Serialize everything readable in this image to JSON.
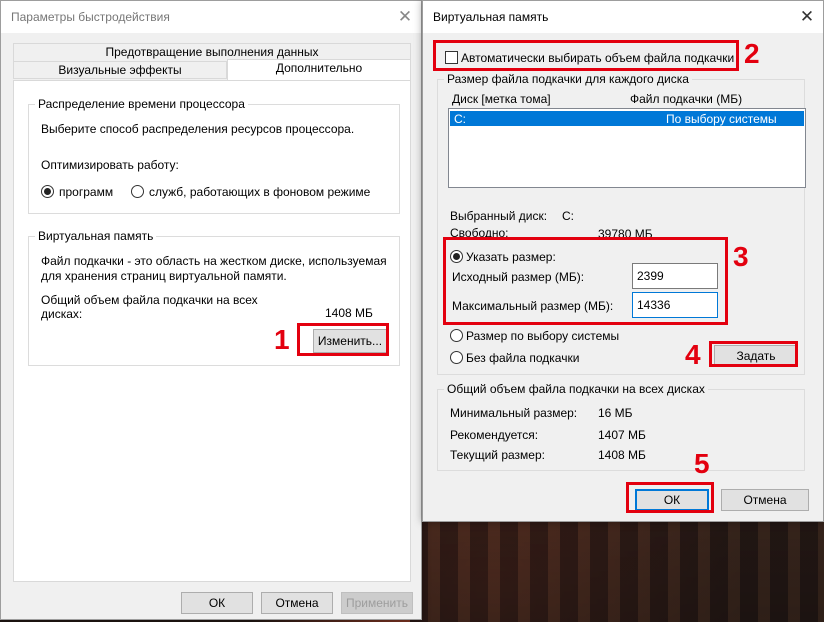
{
  "perf_dialog": {
    "title": "Параметры быстродействия",
    "close_glyph": "✕",
    "tabs": [
      {
        "label": "Предотвращение выполнения данных"
      },
      {
        "label": "Визуальные эффекты"
      },
      {
        "label": "Дополнительно"
      }
    ],
    "cpu_group": {
      "title": "Распределение времени процессора",
      "description": "Выберите способ распределения ресурсов процессора.",
      "optimize_label": "Оптимизировать работу:",
      "options": [
        "программ",
        "служб, работающих в фоновом режиме"
      ],
      "selected_index": 0
    },
    "vm_group": {
      "title": "Виртуальная память",
      "description_line1": "Файл подкачки - это область на жестком диске, используемая",
      "description_line2": "для хранения страниц виртуальной памяти.",
      "total_label_line1": "Общий объем файла подкачки на всех",
      "total_label_line2": "дисках:",
      "total_value": "1408 МБ",
      "change_button": "Изменить..."
    },
    "buttons": {
      "ok": "ОК",
      "cancel": "Отмена",
      "apply": "Применить"
    }
  },
  "vm_dialog": {
    "title": "Виртуальная память",
    "close_glyph": "✕",
    "auto_checkbox_label": "Автоматически выбирать объем файла подкачки",
    "auto_checked": false,
    "disk_group": {
      "title": "Размер файла подкачки для каждого диска",
      "col_disk": "Диск [метка тома]",
      "col_file": "Файл подкачки (МБ)",
      "rows": [
        {
          "disk": "C:",
          "file": "По выбору системы"
        }
      ]
    },
    "selected_disk_label": "Выбранный диск:",
    "selected_disk_value": "C:",
    "free_label": "Свободно:",
    "free_value": "39780 МБ",
    "custom_size_label": "Указать размер:",
    "initial_label": "Исходный размер (МБ):",
    "initial_value": "2399",
    "max_label": "Максимальный размер (МБ):",
    "max_value": "14336",
    "system_size_label": "Размер по выбору системы",
    "no_file_label": "Без файла подкачки",
    "set_button": "Задать",
    "totals_group": {
      "title": "Общий объем файла подкачки на всех дисках",
      "min_label": "Минимальный размер:",
      "min_value": "16 МБ",
      "recommended_label": "Рекомендуется:",
      "recommended_value": "1407 МБ",
      "current_label": "Текущий размер:",
      "current_value": "1408 МБ"
    },
    "buttons": {
      "ok": "ОК",
      "cancel": "Отмена"
    }
  },
  "annotations": {
    "m1": "1",
    "m2": "2",
    "m3": "3",
    "m4": "4",
    "m5": "5",
    "color": "#e3000f"
  }
}
